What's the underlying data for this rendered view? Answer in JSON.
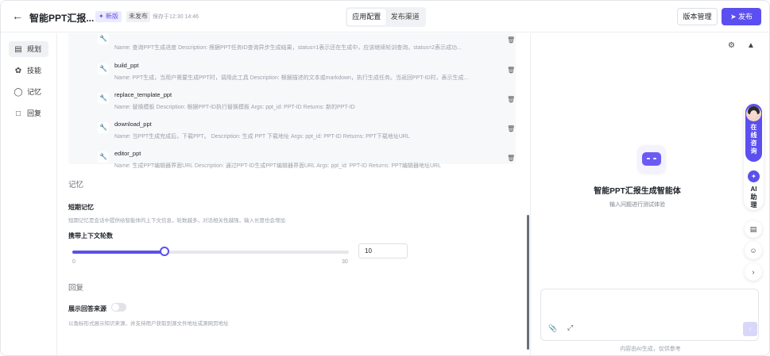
{
  "header": {
    "back_icon": "arrow-left-icon",
    "title": "智能PPT汇报...",
    "badge_new": "✦ 新版",
    "badge_unpublished": "未发布",
    "saved_text": "保存于12:30 14:46",
    "tabs": [
      {
        "label": "应用配置",
        "active": true
      },
      {
        "label": "发布渠道",
        "active": false
      }
    ],
    "version_button": "版本管理",
    "publish_button": "发布",
    "accent_color": "#5b4ff0"
  },
  "sidebar": {
    "items": [
      {
        "label": "规划",
        "icon": "layout-icon",
        "active": true
      },
      {
        "label": "技能",
        "icon": "skills-icon"
      },
      {
        "label": "记忆",
        "icon": "memory-icon"
      },
      {
        "label": "回复",
        "icon": "reply-icon"
      }
    ]
  },
  "tools": [
    {
      "name": "",
      "desc": "Name: 查询PPT生成进度 Description: 根据PPT任务ID查询异步生成结果，status=1表示还在生成中，应该继续轮训查询，status=2表示成功..."
    },
    {
      "name": "build_ppt",
      "desc": "Name: PPT生成，当用户需要生成PPT时，调用此工具 Description: 根据描述的文本或markdown，执行生成任务。当返回PPT-ID时，表示生成..."
    },
    {
      "name": "replace_template_ppt",
      "desc": "Name: 替换模板 Description: 根据PPT-ID执行替换模板 Args: ppt_id: PPT-ID Returns: 新的PPT-ID"
    },
    {
      "name": "download_ppt",
      "desc": "Name: 当PPT生成完成后，下载PPT。 Description: 生成 PPT 下载地址 Args: ppt_id: PPT-ID Returns: PPT下载地址URL"
    },
    {
      "name": "editor_ppt",
      "desc": "Name: 生成PPT编辑器界面URL Description: 通过PPT-ID生成PPT编辑器界面URL Args: ppt_id: PPT-ID Returns: PPT编辑器地址URL"
    }
  ],
  "memory": {
    "section": "记忆",
    "short_title": "短期记忆",
    "short_hint": "短期记忆是会话中提供给智能体的上下文信息，轮数越多，对话相关性越强，输入长度也会增加",
    "rounds_label": "携带上下文轮数",
    "min": "0",
    "max": "30",
    "value": "10",
    "value_num": 10,
    "max_num": 30
  },
  "reply": {
    "section": "回复",
    "show_source_label": "展示回答来源",
    "show_source_on": false,
    "show_source_hint": "以角标形式展示知识来源，并支持用户获取到源文件地址或源网页地址"
  },
  "preview": {
    "agent_name": "智能PPT汇报生成智能体",
    "agent_sub": "输入问题进行测试体验",
    "float_online": "在线咨询",
    "float_ai": "AI助理",
    "input_placeholder": "",
    "footer": "内容由AI生成，仅供参考"
  }
}
